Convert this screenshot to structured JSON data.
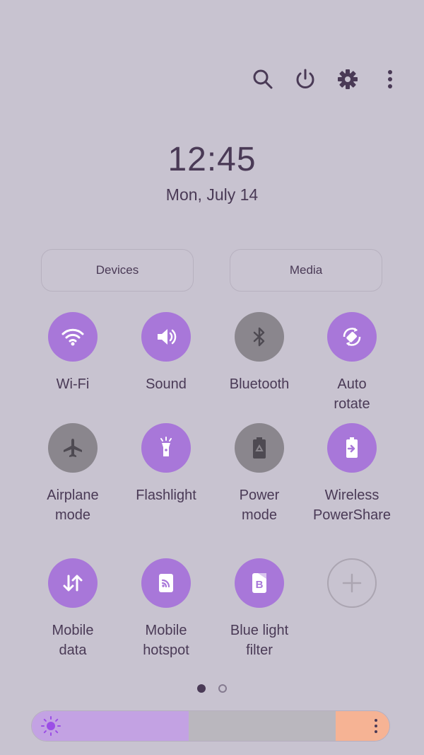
{
  "clock": {
    "time": "12:45",
    "date": "Mon, July 14"
  },
  "top_icons": [
    "search-icon",
    "power-icon",
    "settings-icon",
    "more-vert-icon"
  ],
  "buttons": {
    "devices": "Devices",
    "media": "Media"
  },
  "tiles": [
    {
      "label": "Wi-Fi",
      "state": "on",
      "icon": "wifi-icon"
    },
    {
      "label": "Sound",
      "state": "on",
      "icon": "volume-icon"
    },
    {
      "label": "Bluetooth",
      "state": "off",
      "icon": "bluetooth-icon"
    },
    {
      "label": "Auto\nrotate",
      "state": "on",
      "icon": "auto-rotate-icon"
    },
    {
      "label": "Airplane\nmode",
      "state": "off",
      "icon": "airplane-icon"
    },
    {
      "label": "Flashlight",
      "state": "on",
      "icon": "flashlight-icon"
    },
    {
      "label": "Power\nmode",
      "state": "off",
      "icon": "battery-recycle-icon"
    },
    {
      "label": "Wireless\nPowerShare",
      "state": "on",
      "icon": "powershare-icon"
    },
    {
      "label": "Mobile\ndata",
      "state": "on",
      "icon": "mobile-data-icon"
    },
    {
      "label": "Mobile\nhotspot",
      "state": "on",
      "icon": "hotspot-icon"
    },
    {
      "label": "Blue light\nfilter",
      "state": "on",
      "icon": "blue-light-icon"
    },
    {
      "label": "",
      "state": "add",
      "icon": "add-icon"
    }
  ],
  "pager": {
    "pages": 2,
    "current": 1
  },
  "brightness": {
    "level": 0.44,
    "icon": "sun-icon",
    "menu_icon": "more-vert-icon"
  },
  "colors": {
    "background": "#c8c3d0",
    "accent": "#a877d9",
    "off": "#8a868d",
    "text": "#4a3a56",
    "brightness_fill": "#c3a2e3",
    "brightness_end": "#f6b394"
  }
}
